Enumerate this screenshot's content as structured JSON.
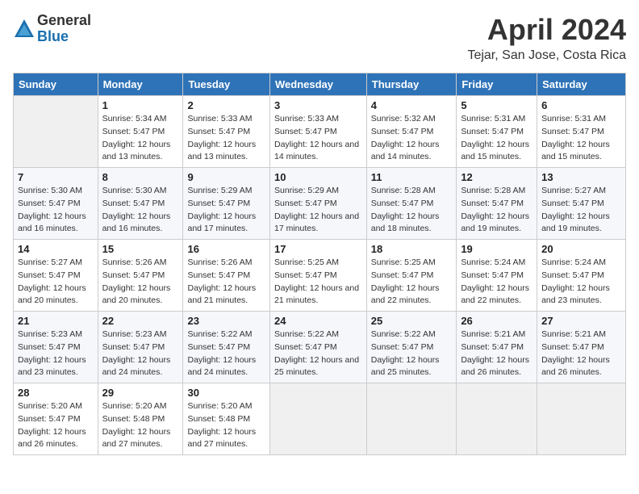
{
  "header": {
    "logo_general": "General",
    "logo_blue": "Blue",
    "month_title": "April 2024",
    "location": "Tejar, San Jose, Costa Rica"
  },
  "columns": [
    "Sunday",
    "Monday",
    "Tuesday",
    "Wednesday",
    "Thursday",
    "Friday",
    "Saturday"
  ],
  "weeks": [
    [
      {
        "day": "",
        "sunrise": "",
        "sunset": "",
        "daylight": "",
        "empty": true
      },
      {
        "day": "1",
        "sunrise": "Sunrise: 5:34 AM",
        "sunset": "Sunset: 5:47 PM",
        "daylight": "Daylight: 12 hours and 13 minutes."
      },
      {
        "day": "2",
        "sunrise": "Sunrise: 5:33 AM",
        "sunset": "Sunset: 5:47 PM",
        "daylight": "Daylight: 12 hours and 13 minutes."
      },
      {
        "day": "3",
        "sunrise": "Sunrise: 5:33 AM",
        "sunset": "Sunset: 5:47 PM",
        "daylight": "Daylight: 12 hours and 14 minutes."
      },
      {
        "day": "4",
        "sunrise": "Sunrise: 5:32 AM",
        "sunset": "Sunset: 5:47 PM",
        "daylight": "Daylight: 12 hours and 14 minutes."
      },
      {
        "day": "5",
        "sunrise": "Sunrise: 5:31 AM",
        "sunset": "Sunset: 5:47 PM",
        "daylight": "Daylight: 12 hours and 15 minutes."
      },
      {
        "day": "6",
        "sunrise": "Sunrise: 5:31 AM",
        "sunset": "Sunset: 5:47 PM",
        "daylight": "Daylight: 12 hours and 15 minutes."
      }
    ],
    [
      {
        "day": "7",
        "sunrise": "Sunrise: 5:30 AM",
        "sunset": "Sunset: 5:47 PM",
        "daylight": "Daylight: 12 hours and 16 minutes."
      },
      {
        "day": "8",
        "sunrise": "Sunrise: 5:30 AM",
        "sunset": "Sunset: 5:47 PM",
        "daylight": "Daylight: 12 hours and 16 minutes."
      },
      {
        "day": "9",
        "sunrise": "Sunrise: 5:29 AM",
        "sunset": "Sunset: 5:47 PM",
        "daylight": "Daylight: 12 hours and 17 minutes."
      },
      {
        "day": "10",
        "sunrise": "Sunrise: 5:29 AM",
        "sunset": "Sunset: 5:47 PM",
        "daylight": "Daylight: 12 hours and 17 minutes."
      },
      {
        "day": "11",
        "sunrise": "Sunrise: 5:28 AM",
        "sunset": "Sunset: 5:47 PM",
        "daylight": "Daylight: 12 hours and 18 minutes."
      },
      {
        "day": "12",
        "sunrise": "Sunrise: 5:28 AM",
        "sunset": "Sunset: 5:47 PM",
        "daylight": "Daylight: 12 hours and 19 minutes."
      },
      {
        "day": "13",
        "sunrise": "Sunrise: 5:27 AM",
        "sunset": "Sunset: 5:47 PM",
        "daylight": "Daylight: 12 hours and 19 minutes."
      }
    ],
    [
      {
        "day": "14",
        "sunrise": "Sunrise: 5:27 AM",
        "sunset": "Sunset: 5:47 PM",
        "daylight": "Daylight: 12 hours and 20 minutes."
      },
      {
        "day": "15",
        "sunrise": "Sunrise: 5:26 AM",
        "sunset": "Sunset: 5:47 PM",
        "daylight": "Daylight: 12 hours and 20 minutes."
      },
      {
        "day": "16",
        "sunrise": "Sunrise: 5:26 AM",
        "sunset": "Sunset: 5:47 PM",
        "daylight": "Daylight: 12 hours and 21 minutes."
      },
      {
        "day": "17",
        "sunrise": "Sunrise: 5:25 AM",
        "sunset": "Sunset: 5:47 PM",
        "daylight": "Daylight: 12 hours and 21 minutes."
      },
      {
        "day": "18",
        "sunrise": "Sunrise: 5:25 AM",
        "sunset": "Sunset: 5:47 PM",
        "daylight": "Daylight: 12 hours and 22 minutes."
      },
      {
        "day": "19",
        "sunrise": "Sunrise: 5:24 AM",
        "sunset": "Sunset: 5:47 PM",
        "daylight": "Daylight: 12 hours and 22 minutes."
      },
      {
        "day": "20",
        "sunrise": "Sunrise: 5:24 AM",
        "sunset": "Sunset: 5:47 PM",
        "daylight": "Daylight: 12 hours and 23 minutes."
      }
    ],
    [
      {
        "day": "21",
        "sunrise": "Sunrise: 5:23 AM",
        "sunset": "Sunset: 5:47 PM",
        "daylight": "Daylight: 12 hours and 23 minutes."
      },
      {
        "day": "22",
        "sunrise": "Sunrise: 5:23 AM",
        "sunset": "Sunset: 5:47 PM",
        "daylight": "Daylight: 12 hours and 24 minutes."
      },
      {
        "day": "23",
        "sunrise": "Sunrise: 5:22 AM",
        "sunset": "Sunset: 5:47 PM",
        "daylight": "Daylight: 12 hours and 24 minutes."
      },
      {
        "day": "24",
        "sunrise": "Sunrise: 5:22 AM",
        "sunset": "Sunset: 5:47 PM",
        "daylight": "Daylight: 12 hours and 25 minutes."
      },
      {
        "day": "25",
        "sunrise": "Sunrise: 5:22 AM",
        "sunset": "Sunset: 5:47 PM",
        "daylight": "Daylight: 12 hours and 25 minutes."
      },
      {
        "day": "26",
        "sunrise": "Sunrise: 5:21 AM",
        "sunset": "Sunset: 5:47 PM",
        "daylight": "Daylight: 12 hours and 26 minutes."
      },
      {
        "day": "27",
        "sunrise": "Sunrise: 5:21 AM",
        "sunset": "Sunset: 5:47 PM",
        "daylight": "Daylight: 12 hours and 26 minutes."
      }
    ],
    [
      {
        "day": "28",
        "sunrise": "Sunrise: 5:20 AM",
        "sunset": "Sunset: 5:47 PM",
        "daylight": "Daylight: 12 hours and 26 minutes."
      },
      {
        "day": "29",
        "sunrise": "Sunrise: 5:20 AM",
        "sunset": "Sunset: 5:48 PM",
        "daylight": "Daylight: 12 hours and 27 minutes."
      },
      {
        "day": "30",
        "sunrise": "Sunrise: 5:20 AM",
        "sunset": "Sunset: 5:48 PM",
        "daylight": "Daylight: 12 hours and 27 minutes."
      },
      {
        "day": "",
        "sunrise": "",
        "sunset": "",
        "daylight": "",
        "empty": true
      },
      {
        "day": "",
        "sunrise": "",
        "sunset": "",
        "daylight": "",
        "empty": true
      },
      {
        "day": "",
        "sunrise": "",
        "sunset": "",
        "daylight": "",
        "empty": true
      },
      {
        "day": "",
        "sunrise": "",
        "sunset": "",
        "daylight": "",
        "empty": true
      }
    ]
  ]
}
